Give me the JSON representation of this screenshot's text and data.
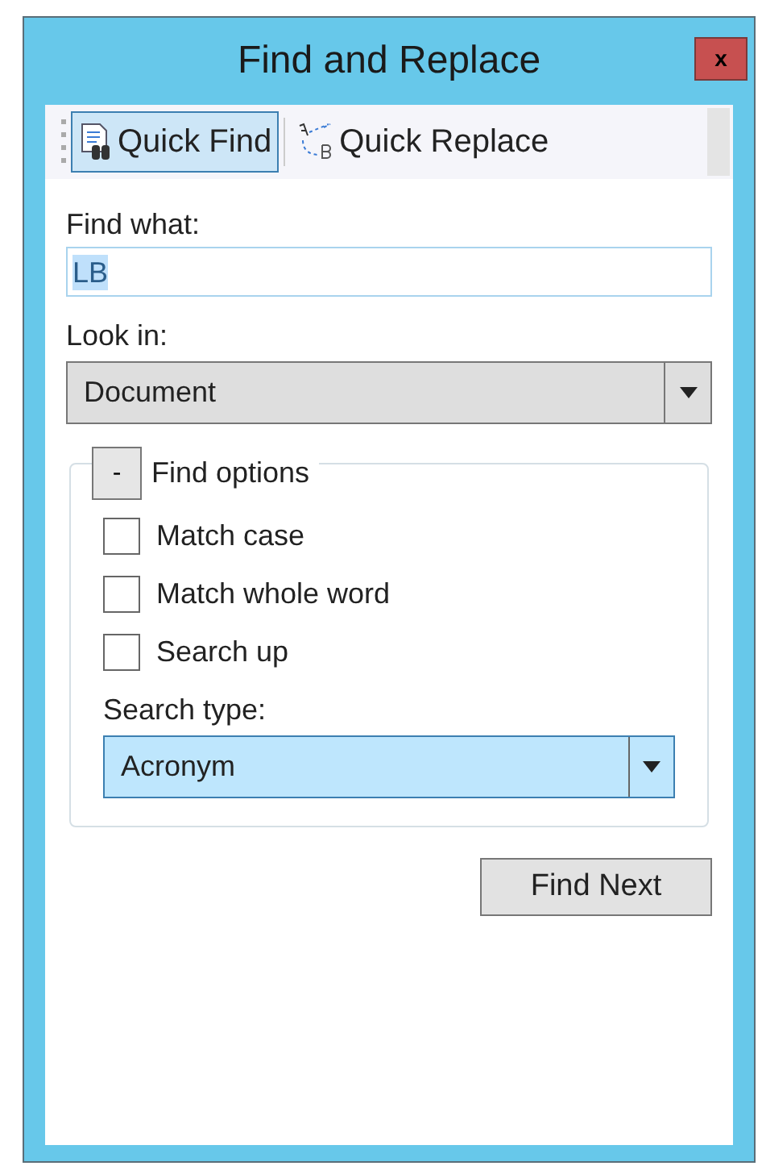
{
  "window": {
    "title": "Find and Replace",
    "close": "x"
  },
  "tabs": [
    {
      "label": "Quick Find",
      "selected": true,
      "kind": "find"
    },
    {
      "label": "Quick Replace",
      "selected": false,
      "kind": "replace"
    }
  ],
  "find_what": {
    "label": "Find what:",
    "value": "LB"
  },
  "look_in": {
    "label": "Look in:",
    "value": "Document"
  },
  "find_options": {
    "toggle": "-",
    "title": "Find options",
    "expanded": true,
    "checkboxes": [
      {
        "label": "Match case",
        "checked": false
      },
      {
        "label": "Match whole word",
        "checked": false
      },
      {
        "label": "Search up",
        "checked": false
      }
    ],
    "search_type": {
      "label": "Search type:",
      "value": "Acronym"
    }
  },
  "buttons": [
    "Find Next"
  ]
}
